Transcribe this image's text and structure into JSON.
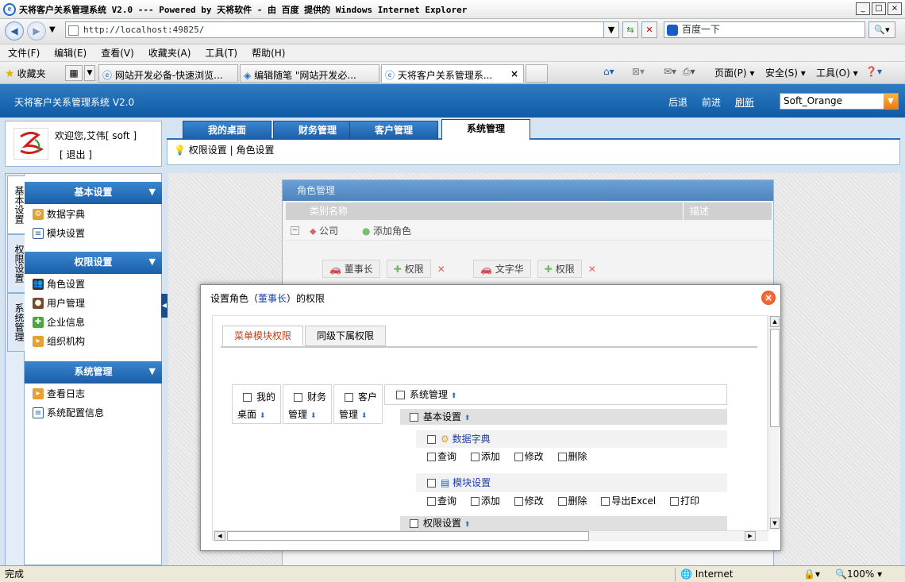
{
  "window": {
    "title": "天将客户关系管理系统 V2.0 --- Powered by 天将软件 - 由 百度 提供的 Windows Internet Explorer",
    "min": "_",
    "max": "□",
    "close": "×"
  },
  "address": {
    "url": "http://localhost:49825/"
  },
  "search": {
    "text": "百度一下"
  },
  "menu": [
    "文件(F)",
    "编辑(E)",
    "查看(V)",
    "收藏夹(A)",
    "工具(T)",
    "帮助(H)"
  ],
  "browser_tabs": {
    "favorites": "收藏夹",
    "tabs": [
      "网站开发必备-快速浏览...",
      "编辑随笔 \"网站开发必...",
      "天将客户关系管理系..."
    ],
    "tab_close": "×"
  },
  "toolbar": {
    "page": "页面(P)",
    "safety": "安全(S)",
    "tools": "工具(O)"
  },
  "app": {
    "title": "天将客户关系管理系统 V2.0",
    "nav": [
      "后退",
      "前进",
      "刷新"
    ],
    "theme": "Soft_Orange"
  },
  "user": {
    "welcome": "欢迎您,艾伟[ soft ]",
    "logout": "[ 退出 ]"
  },
  "main_tabs": [
    "我的桌面",
    "财务管理",
    "客户管理",
    "系统管理"
  ],
  "subnav": {
    "items": [
      "权限设置",
      "角色设置"
    ],
    "sep": "|"
  },
  "sidebar": {
    "vtabs": [
      "基本设置",
      "权限设置",
      "系统管理"
    ],
    "sections": [
      {
        "title": "基本设置",
        "items": [
          "数据字典",
          "模块设置"
        ]
      },
      {
        "title": "权限设置",
        "items": [
          "角色设置",
          "用户管理",
          "企业信息",
          "组织机构"
        ]
      },
      {
        "title": "系统管理",
        "items": [
          "查看日志",
          "系统配置信息"
        ]
      }
    ]
  },
  "role_panel": {
    "title": "角色管理",
    "col1": "类别名称",
    "col2": "描述",
    "row_company": "公司",
    "add_role": "添加角色",
    "roles": [
      {
        "name": "董事长",
        "perm": "权限"
      },
      {
        "name": "文字华",
        "perm": "权限"
      }
    ]
  },
  "modal": {
    "title_prefix": "设置角色（",
    "role": "董事长",
    "title_suffix": "）的权限",
    "tabs": [
      "菜单模块权限",
      "同级下属权限"
    ],
    "top_modules": [
      {
        "line1": "我的",
        "line2": "桌面"
      },
      {
        "line1": "财务",
        "line2": "管理"
      },
      {
        "line1": "客户",
        "line2": "管理"
      }
    ],
    "system_module": "系统管理",
    "basic": "基本设置",
    "dict": {
      "name": "数据字典",
      "ops": [
        "查询",
        "添加",
        "修改",
        "删除"
      ]
    },
    "module": {
      "name": "模块设置",
      "ops": [
        "查询",
        "添加",
        "修改",
        "删除",
        "导出Excel",
        "打印"
      ]
    },
    "perm_settings": "权限设置"
  },
  "status": {
    "left": "完成",
    "zone": "Internet",
    "zoom": "100%"
  }
}
